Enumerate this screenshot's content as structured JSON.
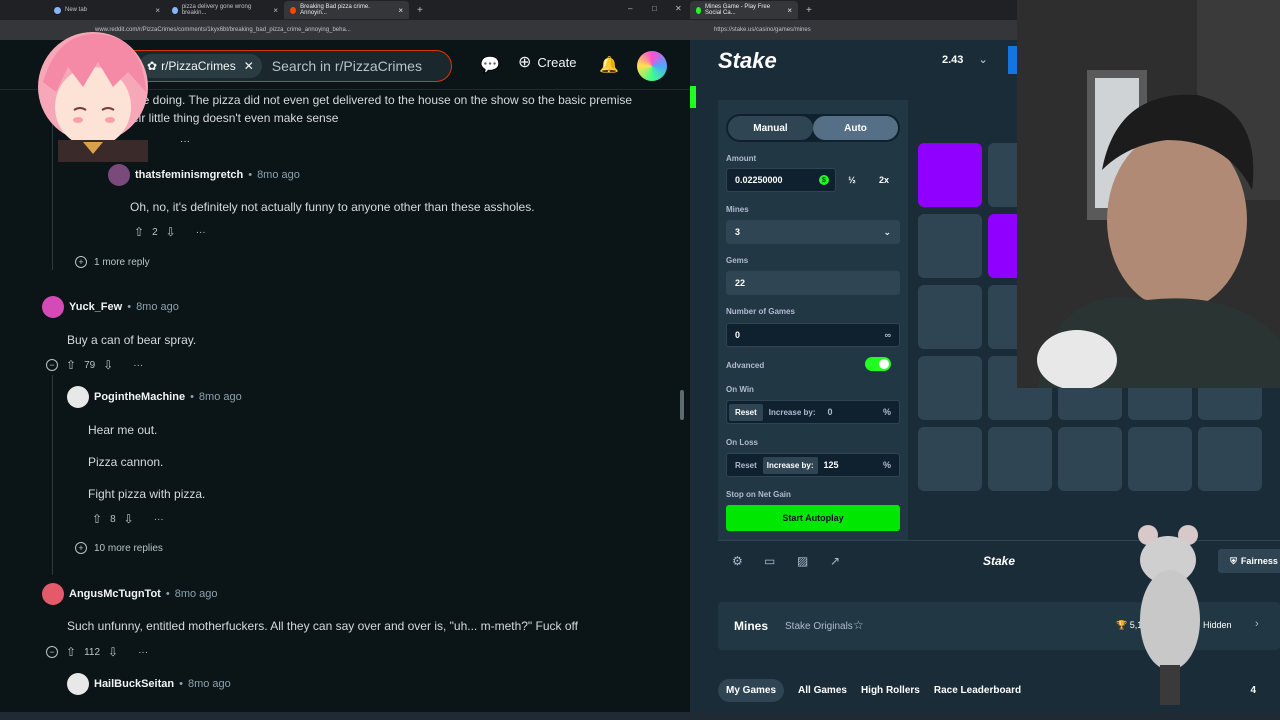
{
  "browser_left": {
    "tabs": [
      {
        "label": "New tab"
      },
      {
        "label": "pizza delivery gone wrong breakin..."
      },
      {
        "label": "Breaking Bad pizza crime. Annoyin..."
      }
    ],
    "url": "www.reddit.com/r/PizzaCrimes/comments/1kyx6bt/breaking_bad_pizza_crime_annoying_beha..."
  },
  "reddit": {
    "subreddit_chip": "r/PizzaCrimes",
    "search_placeholder": "Search in r/PizzaCrimes",
    "create_label": "Create",
    "comments": [
      {
        "text1": "are doing. The pizza did not even get delivered to the house on the show so the basic premise",
        "text2": "eir little thing doesn't even make sense"
      },
      {
        "user": "thatsfeminismgretch",
        "time": "8mo ago",
        "text": "Oh, no, it's definitely not actually funny to anyone other than these assholes.",
        "votes": "2",
        "more": "1 more reply"
      },
      {
        "user": "Yuck_Few",
        "time": "8mo ago",
        "text": "Buy a can of bear spray.",
        "votes": "79"
      },
      {
        "user": "PogintheMachine",
        "time": "8mo ago",
        "lines": [
          "Hear me out.",
          "Pizza cannon.",
          "Fight pizza with pizza."
        ],
        "votes": "8",
        "more": "10 more replies"
      },
      {
        "user": "AngusMcTugnTot",
        "time": "8mo ago",
        "text": "Such unfunny, entitled motherfuckers. All they can say over and over is, \"uh... m-meth?\" Fuck off",
        "votes": "112"
      },
      {
        "user": "HailBuckSeitan",
        "time": "8mo ago"
      }
    ],
    "ellipsis": "···"
  },
  "browser_right": {
    "tab": "Mines Game - Play Free Social Ca...",
    "url": "https://stake.us/casino/games/mines"
  },
  "stake": {
    "logo": "Stake",
    "balance": "2.43",
    "mode_manual": "Manual",
    "mode_auto": "Auto",
    "amount_label": "Amount",
    "amount_value": "0.02250000",
    "half": "½",
    "double": "2x",
    "mines_label": "Mines",
    "mines_value": "3",
    "gems_label": "Gems",
    "gems_value": "22",
    "num_games_label": "Number of Games",
    "num_games_value": "0",
    "infinity": "∞",
    "advanced_label": "Advanced",
    "advanced_on": true,
    "on_win_label": "On Win",
    "on_win_reset": "Reset",
    "on_win_increase": "Increase by:",
    "on_win_value": "0",
    "on_loss_label": "On Loss",
    "on_loss_reset": "Reset",
    "on_loss_increase": "Increase by:",
    "on_loss_value": "125",
    "percent": "%",
    "stop_label": "Stop on Net Gain",
    "start_button": "Start Autoplay",
    "fairness": "Fairness",
    "footer_logo": "Stake",
    "game_name": "Mines",
    "game_sub": "Stake Originals",
    "trophy_value": "5,1",
    "hidden": "Hidden",
    "tabs": [
      "My Games",
      "All Games",
      "High Rollers",
      "Race Leaderboard"
    ],
    "tab_count": "4",
    "colors": {
      "accent_green": "#00e701",
      "gem_purple": "#9000ff",
      "tile": "#2f4553"
    }
  }
}
